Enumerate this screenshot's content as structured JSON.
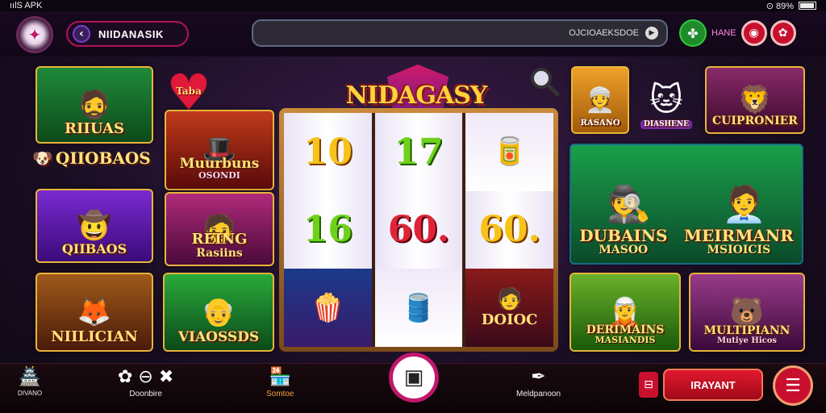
{
  "status_bar": {
    "left": "ıılS APK",
    "right": "⊙ 89%"
  },
  "header": {
    "back_label": "NIIDANASIK",
    "search_text": "OJCIOAEKSDOE",
    "right_label": "HANE"
  },
  "title": "NIDAGASY",
  "heart_label": "Taba",
  "tiles": [
    {
      "name": "RIIUAS",
      "sub": "",
      "color": "#1a7a3a"
    },
    {
      "name": "QIIOBAOS",
      "sub": "",
      "color": ""
    },
    {
      "name": "QIIBAOS",
      "sub": "",
      "color": "#6a1ab0"
    },
    {
      "name": "NIILICIAN",
      "sub": "",
      "color": "#8a4a10"
    },
    {
      "name": "Muurbuns",
      "sub": "OSONDI",
      "color": ""
    },
    {
      "name": "REING",
      "sub": "Rasiins",
      "color": "#8a1a5a"
    },
    {
      "name": "VIAOSSDS",
      "sub": "",
      "color": "#1a8a2a"
    },
    {
      "name": "RASANO",
      "sub": "",
      "color": "#d08a1a"
    },
    {
      "name": "DIASHENE",
      "sub": "",
      "color": "#d0a010"
    },
    {
      "name": "CUIPRONIER",
      "sub": "",
      "color": "#6a1a5a"
    },
    {
      "name": "DUBAINS",
      "sub": "MASOO",
      "color": "#0f7a3a"
    },
    {
      "name": "MEIRMANR",
      "sub": "MSIOICIS",
      "color": "#0f7a3a"
    },
    {
      "name": "DERIMAINS",
      "sub": "MASIANDIS",
      "color": "#4a8a1a"
    },
    {
      "name": "MULTIPIANN",
      "sub": "Mutiye Hicos",
      "color": "#7a2a6a"
    }
  ],
  "reels": [
    [
      "10",
      "16",
      ""
    ],
    [
      "17",
      "60.",
      ""
    ],
    [
      "",
      "60.",
      "DOIOC"
    ]
  ],
  "bottom_nav": {
    "item1_label": "DIVANO",
    "item2_label": "Doonbire",
    "item3_label": "Somtoe",
    "item4_label": "Meldpanoon",
    "play_label": "IRAYANT"
  }
}
